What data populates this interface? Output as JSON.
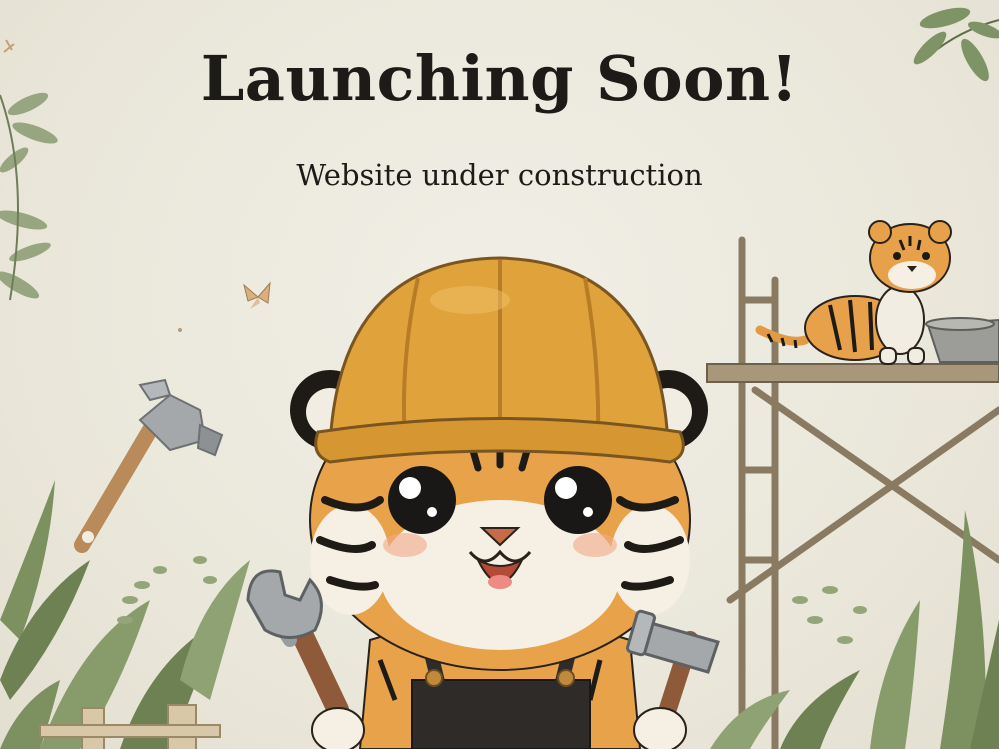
{
  "hero": {
    "title": "Launching Soon!",
    "subtitle": "Website under construction"
  },
  "illustration": {
    "main_character": "tiger-cub-with-hard-hat",
    "tools": [
      "wrench-icon",
      "hammer-icon",
      "adjustable-wrench-icon"
    ],
    "scene": [
      "scaffolding",
      "small-tiger-on-scaffold",
      "bowl",
      "leaves",
      "wooden-fence"
    ],
    "colors": {
      "background": "#ebe8dc",
      "hard_hat": "#e0a33c",
      "fur_orange": "#e8a24a",
      "stripes": "#1e1a16",
      "overalls": "#2e2b28",
      "leaves": "#7f9466",
      "wood": "#8a7a62"
    }
  }
}
